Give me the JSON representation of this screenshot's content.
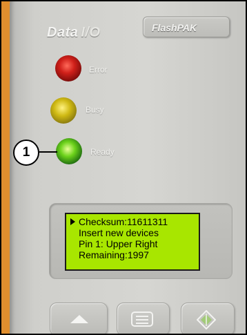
{
  "device": {
    "brand": "Data",
    "brand_mark": "I/O",
    "model_label": "FlashPAK"
  },
  "leds": [
    {
      "label": "Error",
      "color": "#d0201a"
    },
    {
      "label": "Busy",
      "color": "#cfb913"
    },
    {
      "label": "Ready",
      "color": "#6cd21b"
    }
  ],
  "callout": {
    "number": "1"
  },
  "lcd": {
    "background": "#a8e600",
    "lines": [
      "Checksum:11611311",
      "Insert new devices",
      "Pin 1: Upper Right",
      "Remaining:1997"
    ]
  },
  "buttons": [
    {
      "icon": "up-arrow-icon"
    },
    {
      "icon": "menu-icon"
    },
    {
      "icon": "start-diamond-icon"
    }
  ],
  "colors": {
    "background_accent": "#e08e2e",
    "panel": "#d2d2ce"
  }
}
